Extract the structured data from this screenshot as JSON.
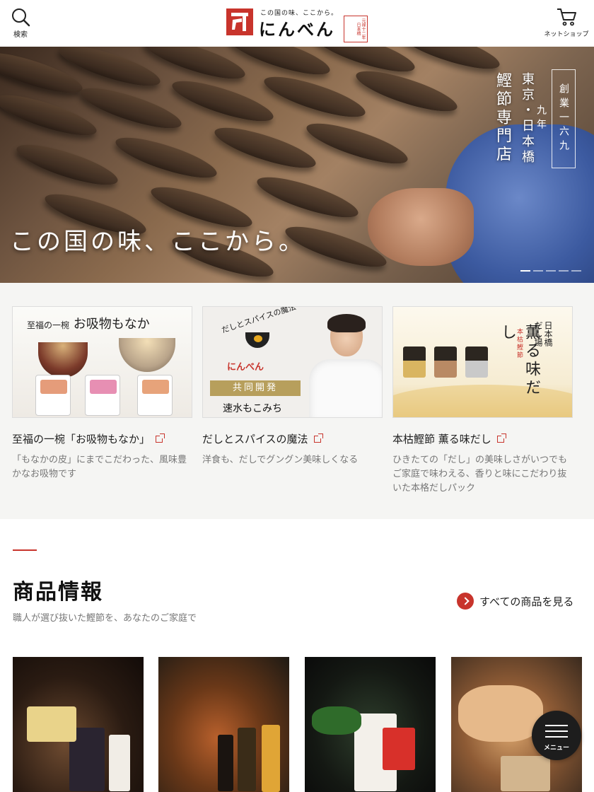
{
  "header": {
    "search_label": "検索",
    "logo_tagline": "この国の味、ここから。",
    "logo_wordmark": "にんべん",
    "logo_seal": "元禄十二年 日本橋",
    "shop_label": "ネットショップ"
  },
  "hero": {
    "copy": "この国の味、ここから。",
    "vertical_main": "鰹節専門店",
    "vertical_sub": "東京・日本橋",
    "since": "創業一六九九年",
    "slide_count": 5,
    "active_slide": 1
  },
  "features": [
    {
      "image": {
        "lead": "至福の一椀",
        "headline": "お吸物もなか"
      },
      "title": "至福の一椀「お吸物もなか」",
      "description": "「もなかの皮」にまでこだわった、風味豊かなお吸物です"
    },
    {
      "image": {
        "arc_text": "だしとスパイスの魔法",
        "brand": "にんべん",
        "band": "共同開発",
        "name": "速水もこみち"
      },
      "title": "だしとスパイスの魔法",
      "description": "洋食も、だしでグングン美味しくなる"
    },
    {
      "image": {
        "headline": "薫る味だし",
        "small": "本枯鰹節",
        "shop": "日本橋だし場"
      },
      "title": "本枯鰹節 薫る味だし",
      "description": "ひきたての「だし」の美味しさがいつでもご家庭で味わえる、香りと味にこだわり抜いた本格だしパック"
    }
  ],
  "products_section": {
    "title": "商品情報",
    "subtitle": "職人が選び抜いた鰹節を、あなたのご家庭で",
    "see_all": "すべての商品を見る"
  },
  "menu_button": {
    "label": "メニュー"
  },
  "colors": {
    "accent": "#c8342c",
    "feature_bg": "#f5f5f3",
    "menu_bg": "#1d1d1d"
  },
  "icons": {
    "search": "search-icon",
    "cart": "cart-icon",
    "external": "external-link-icon",
    "arrow": "chevron-right-icon",
    "menu": "hamburger-icon"
  }
}
